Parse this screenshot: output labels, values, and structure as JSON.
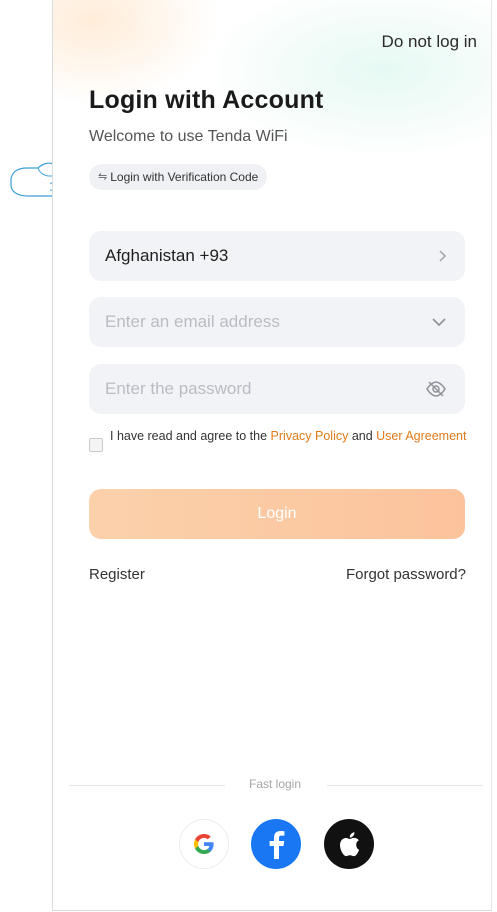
{
  "header": {
    "skip_label": "Do not log in",
    "title": "Login with Account",
    "subtitle": "Welcome to use Tenda WiFi"
  },
  "switch_mode": {
    "label": "Login with Verification Code",
    "icon": "swap-icon"
  },
  "form": {
    "country": {
      "value": "Afghanistan +93",
      "icon": "chevron-right-icon"
    },
    "email": {
      "placeholder": "Enter an email address",
      "icon": "chevron-down-icon"
    },
    "password": {
      "placeholder": "Enter the password",
      "icon": "eye-off-icon"
    },
    "agreement": {
      "checked": false,
      "prefix": "I have read and agree to the ",
      "privacy_link": "Privacy Policy",
      "and": " and ",
      "user_link": "User Agreement"
    },
    "login_label": "Login"
  },
  "links": {
    "register": "Register",
    "forgot": "Forgot password?"
  },
  "fast_login": {
    "label": "Fast login",
    "providers": [
      "google-icon",
      "facebook-icon",
      "apple-icon"
    ]
  },
  "colors": {
    "accent": "#e07a1a",
    "login_button": "#fbc9a3",
    "field_bg": "#f2f3f6",
    "facebook": "#1977f3"
  }
}
